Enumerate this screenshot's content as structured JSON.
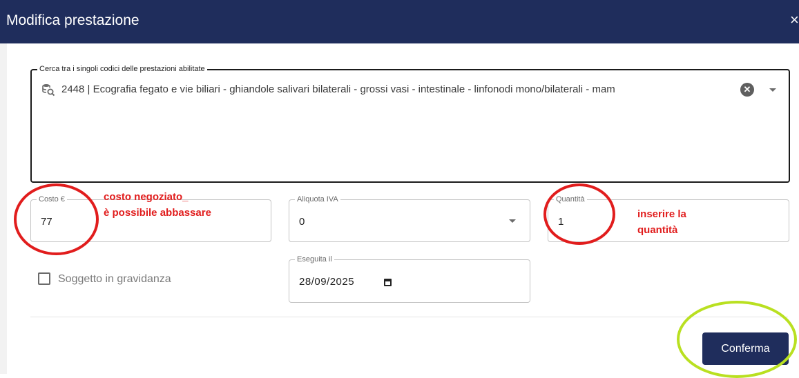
{
  "dialog": {
    "title": "Modifica prestazione",
    "close_label": "×"
  },
  "search": {
    "label": "Cerca tra i singoli codici delle prestazioni abilitate",
    "value": "2448 | Ecografia fegato e vie biliari - ghiandole salivari bilaterali - grossi vasi - intestinale - linfonodi mono/bilaterali - mam",
    "icon": "search-database-icon"
  },
  "fields": {
    "costo": {
      "label": "Costo €",
      "value": "77"
    },
    "aliquota": {
      "label": "Aliquota IVA",
      "value": "0"
    },
    "quantita": {
      "label": "Quantità",
      "value": "1"
    },
    "eseguita": {
      "label": "Eseguita il",
      "value": "28/09/2025"
    }
  },
  "gravidanza": {
    "label": "Soggetto in gravidanza",
    "checked": false
  },
  "actions": {
    "confirm_label": "Conferma"
  },
  "annotations": {
    "costo_note_line1": "costo negoziato_",
    "costo_note_line2": "è possibile abbassare",
    "quantita_note_line1": "inserire la",
    "quantita_note_line2": "quantità",
    "circle_color_red": "#e11d1d",
    "circle_color_green": "#b9e021"
  },
  "colors": {
    "primary": "#1f2d5c"
  }
}
